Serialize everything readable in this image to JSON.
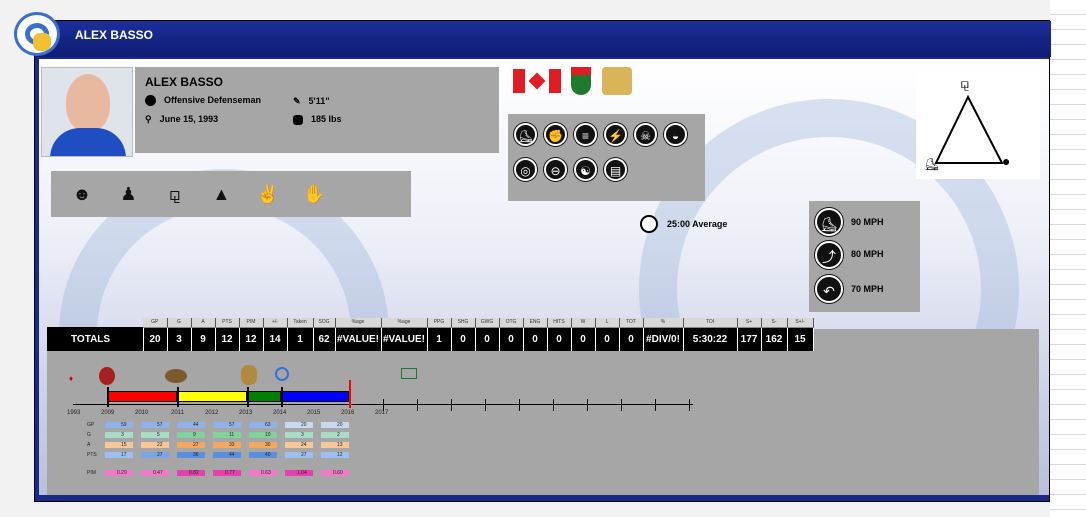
{
  "header": {
    "title": "ALEX BASSO",
    "team_logo": "ram-logo-icon"
  },
  "player": {
    "name": "ALEX BASSO",
    "position": "Offensive Defenseman",
    "birthdate": "June 15, 1993",
    "height": "5'11\"",
    "weight": "185 lbs"
  },
  "flags": [
    "flag-canada-icon",
    "flag-ontario-icon",
    "coat-of-arms-icon"
  ],
  "traits": [
    "face-trait-icon",
    "suit-trait-icon",
    "weightlifter-trait-icon",
    "graduation-cap-icon",
    "thumbs-up-icon",
    "handshake-icon"
  ],
  "skills_row1": [
    "skater-icon",
    "fist-icon",
    "burger-icon",
    "lightning-icon",
    "skull-icon",
    "helmet-icon"
  ],
  "skills_row2": [
    "target-icon",
    "puck-icon",
    "yin-yang-icon",
    "mask-icon"
  ],
  "toi_text": "25:00 Average",
  "speeds": [
    "90 MPH",
    "80 MPH",
    "70 MPH"
  ],
  "stats": {
    "headers": [
      "GP",
      "G",
      "A",
      "PTS",
      "PIM",
      "+/-",
      "Taken",
      "SOG",
      "%age",
      "%age",
      "PPG",
      "SHG",
      "GWG",
      "OTG",
      "ENG",
      "HITS",
      "W",
      "L",
      "TOT",
      "%",
      "TOI",
      "S+",
      "S-",
      "S+/-"
    ],
    "row_label": "TOTALS",
    "values": [
      "20",
      "3",
      "9",
      "12",
      "12",
      "14",
      "1",
      "62",
      "#VALUE!",
      "#VALUE!",
      "1",
      "0",
      "0",
      "0",
      "0",
      "0",
      "0",
      "0",
      "0",
      "#DIV/0!",
      "5:30:22",
      "177",
      "162",
      "15"
    ]
  },
  "timeline": {
    "years": [
      "1993",
      "2009",
      "2010",
      "2011",
      "2012",
      "2013",
      "2014",
      "2015",
      "2016",
      "2017"
    ],
    "segment_colors": [
      "#ff0000",
      "#ffff00",
      "#008000",
      "#0000ff"
    ]
  },
  "mini_rows": {
    "labels": [
      "GP",
      "G",
      "A",
      "PTS",
      "PIM"
    ],
    "gp": [
      "59",
      "57",
      "44",
      "57",
      "63",
      "20",
      "20"
    ],
    "g": [
      "3",
      "5",
      "9",
      "11",
      "10",
      "3",
      "2"
    ],
    "a": [
      "15",
      "22",
      "27",
      "33",
      "30",
      "24",
      "13"
    ],
    "pts": [
      "17",
      "27",
      "36",
      "44",
      "40",
      "27",
      "12"
    ],
    "pim": [
      "0.29",
      "0.47",
      "0.82",
      "0.77",
      "0.63",
      "1.04",
      "0.60"
    ]
  }
}
